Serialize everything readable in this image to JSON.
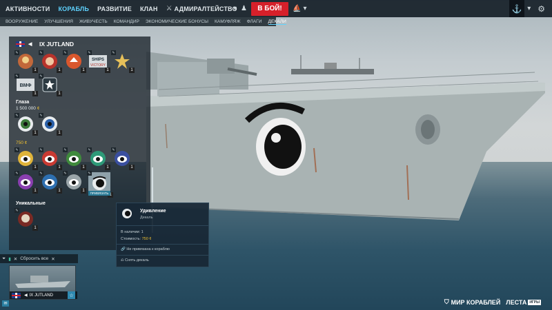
{
  "colors": {
    "accent": "#5fd3ff",
    "battle": "#d6202a",
    "gold": "#f2c230",
    "panel": "#19232a"
  },
  "topbar": {
    "nav": [
      "АКТИВНОСТИ",
      "КОРАБЛЬ",
      "РАЗВИТИЕ",
      "КЛАН",
      "АДМИРАЛТЕЙСТВО"
    ],
    "active_index": 1,
    "battle_button": "В БОЙ!"
  },
  "subnav": {
    "items": [
      "ВООРУЖЕНИЕ",
      "УЛУЧШЕНИЯ",
      "ЖИВУЧЕСТЬ",
      "КОМАНДИР",
      "ЭКОНОМИЧЕСКИЕ БОНУСЫ",
      "КАМУФЛЯЖ",
      "ФЛАГИ",
      "ДЕКАЛИ"
    ],
    "active_index": 7
  },
  "panel": {
    "ship_title": "IX JUTLAND",
    "top_counts": [
      "1",
      "1",
      "1",
      "1",
      "1",
      "1",
      "1"
    ],
    "ships_of_victory": "SHIPS OF VICTORY",
    "vmf": "ВМФ",
    "eyes_title": "Глаза",
    "eyes_price": "1 500 000",
    "eyes_counts": [
      "1",
      "1"
    ],
    "price_750": "750",
    "grid_counts": [
      "1",
      "1",
      "1",
      "1",
      "1",
      "1",
      "1",
      "1",
      "1"
    ],
    "bind_label": "ПРИВЯЗАТЬ",
    "unique_title": "Уникальные",
    "unique_counts": [
      "1"
    ]
  },
  "tooltip": {
    "title": "Удивление",
    "subtitle": "Декаль",
    "in_stock_label": "В наличии:",
    "in_stock_value": "1",
    "cost_label": "Стоимость:",
    "cost_value": "750",
    "not_bound": "Не привязана к кораблю",
    "remove": "Снять декаль"
  },
  "filter": {
    "reset": "Сбросить все"
  },
  "carousel": {
    "ship_name": "IX JUTLAND"
  },
  "brand": {
    "game": "МИР КОРАБЛЕЙ",
    "studio": "ЛЕСТА",
    "studio_tag": "ИГРЫ"
  }
}
